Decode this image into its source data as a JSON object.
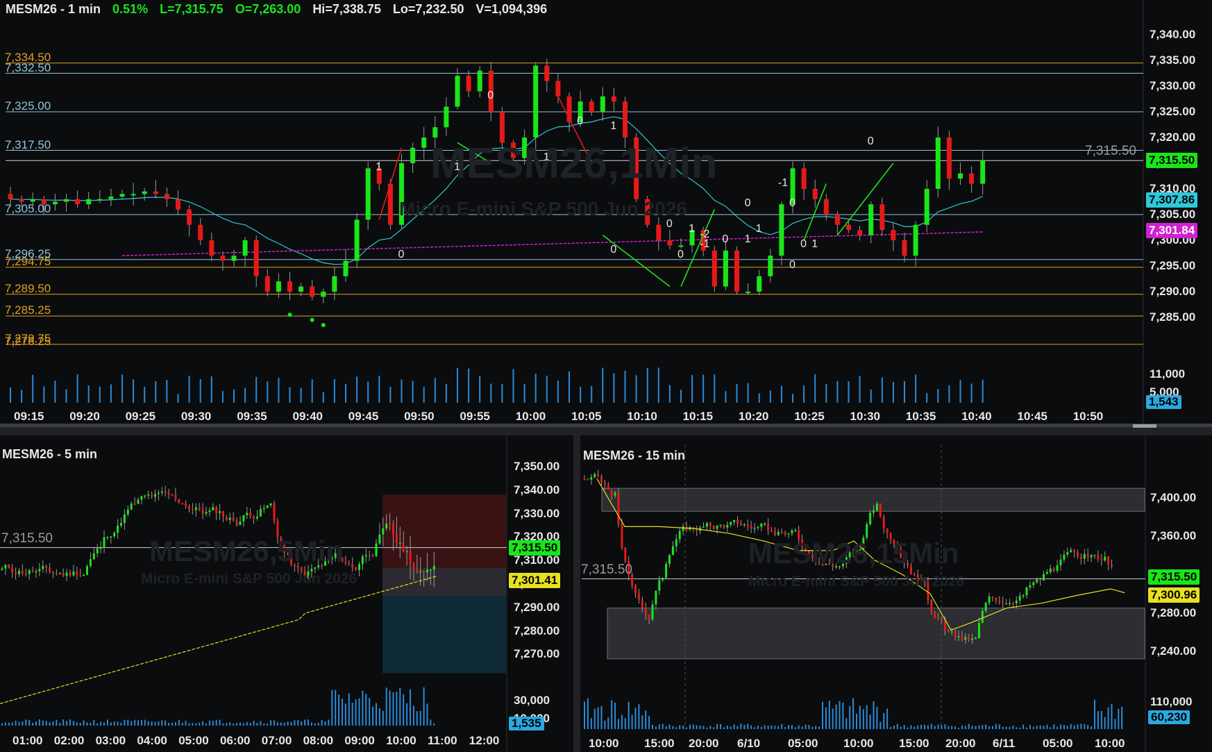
{
  "colors": {
    "bg": "#0b0c0e",
    "up": "#19e619",
    "down": "#e61919",
    "grid": "#1a1c20",
    "axis_text": "#e8e8e8",
    "hline_blue": "#8fc7df",
    "hline_orange": "#e0a020",
    "ema_cyan": "#2fc8d8",
    "vwap_magenta": "#d020d0",
    "sma_yellow": "#e8e020",
    "volume": "#2a8bd8"
  },
  "top": {
    "header": {
      "symbol": "MESM26 - 1 min",
      "change": "0.51%",
      "last": "L=7,315.75",
      "open": "O=7,263.00",
      "high": "Hi=7,338.75",
      "low": "Lo=7,232.50",
      "volume": "V=1,094,396"
    },
    "watermark": "MESM26,1Min",
    "watermark_sub": "Micro E-mini S&P 500 Jun 2026",
    "yaxis": [
      "7,340.00",
      "7,335.00",
      "7,330.00",
      "7,325.00",
      "7,320.00",
      "7,315.00",
      "7,310.00",
      "7,305.00",
      "7,300.00",
      "7,295.00",
      "7,290.00",
      "7,285.00"
    ],
    "price_tags": [
      {
        "text": "7,315.50",
        "price": 7315.5,
        "bg": "#19e619",
        "fg": "#000000"
      },
      {
        "text": "7,307.86",
        "price": 7307.86,
        "bg": "#2fc8d8",
        "fg": "#000000"
      },
      {
        "text": "7,301.84",
        "price": 7301.84,
        "bg": "#d020d0",
        "fg": "#ffffff"
      }
    ],
    "last_price_label": "7,315.50",
    "volume_axis": [
      "11,000",
      "5,000"
    ],
    "volume_tag": "1,543",
    "xaxis": [
      "09:15",
      "09:20",
      "09:25",
      "09:30",
      "09:35",
      "09:40",
      "09:45",
      "09:50",
      "09:55",
      "10:00",
      "10:05",
      "10:10",
      "10:15",
      "10:20",
      "10:25",
      "10:30",
      "10:35",
      "10:40",
      "10:45",
      "10:50"
    ],
    "hlines": [
      {
        "label": "7,334.50",
        "price": 7334.5,
        "color": "orange"
      },
      {
        "label": "7,332.50",
        "price": 7332.5,
        "color": "blue"
      },
      {
        "label": "7,325.00",
        "price": 7325.0,
        "color": "blue"
      },
      {
        "label": "7,317.50",
        "price": 7317.5,
        "color": "blue"
      },
      {
        "label": "7,305.00",
        "price": 7305.0,
        "color": "blue"
      },
      {
        "label": "7,296.25",
        "price": 7296.25,
        "color": "blue"
      },
      {
        "label": "7,294.75",
        "price": 7294.75,
        "color": "orange"
      },
      {
        "label": "7,289.50",
        "price": 7289.5,
        "color": "orange"
      },
      {
        "label": "7,285.25",
        "price": 7285.25,
        "color": "orange"
      },
      {
        "label": "7,279.75",
        "price": 7279.75,
        "color": "orange"
      },
      {
        "label": "7,276.25",
        "price": 7276.25,
        "color": "orange"
      }
    ],
    "annotations": [
      "1",
      "0",
      "1",
      "0",
      "0",
      "1",
      "0",
      "1",
      "0",
      "1",
      "0",
      "-1",
      "-2",
      "0",
      "1",
      "0",
      "1",
      "-1",
      "0",
      "0",
      "1",
      "0",
      "0"
    ]
  },
  "bottom_left": {
    "header": "MESM26 - 5 min",
    "watermark": "MESM26,5Min",
    "watermark_sub": "Micro E-mini S&P 500 Jun 2026",
    "yaxis": [
      "7,350.00",
      "7,340.00",
      "7,330.00",
      "7,320.00",
      "7,310.00",
      "7,300.00",
      "7,290.00",
      "7,280.00",
      "7,270.00"
    ],
    "price_tags": [
      {
        "text": "7,315.50",
        "price": 7315.5,
        "bg": "#19e619",
        "fg": "#000000"
      },
      {
        "text": "7,301.41",
        "price": 7301.41,
        "bg": "#e8e020",
        "fg": "#000000"
      }
    ],
    "last_price_label": "7,315.50",
    "volume_axis": [
      "30,000",
      "10,000"
    ],
    "volume_tag": "1,535",
    "xaxis": [
      "01:00",
      "02:00",
      "03:00",
      "04:00",
      "05:00",
      "06:00",
      "07:00",
      "08:00",
      "09:00",
      "10:00",
      "11:00",
      "12:00"
    ]
  },
  "bottom_right": {
    "header": "MESM26 - 15 min",
    "watermark": "MESM26,15Min",
    "watermark_sub": "Micro E-mini S&P 500 Jun 2026",
    "yaxis": [
      "7,400.00",
      "7,360.00",
      "7,320.00",
      "7,280.00",
      "7,240.00"
    ],
    "price_tags": [
      {
        "text": "7,315.50",
        "price": 7315.5,
        "bg": "#19e619",
        "fg": "#000000"
      },
      {
        "text": "7,300.96",
        "price": 7300.96,
        "bg": "#e8e020",
        "fg": "#000000"
      }
    ],
    "last_price_label": "7,315.50",
    "volume_axis": [
      "110,000"
    ],
    "volume_tag": "60,230",
    "xaxis": [
      "10:00",
      "15:00",
      "20:00",
      "6/10",
      "05:00",
      "10:00",
      "15:00",
      "20:00",
      "6/11",
      "05:00",
      "10:00"
    ]
  },
  "chart_data": [
    {
      "type": "candlestick",
      "title": "MESM26 - 1 min",
      "ylim": [
        7280,
        7342
      ],
      "x": [
        "09:15",
        "09:16",
        "09:17",
        "09:18",
        "09:19",
        "09:20",
        "09:21",
        "09:22",
        "09:23",
        "09:24",
        "09:25",
        "09:26",
        "09:27",
        "09:28",
        "09:29",
        "09:30",
        "09:31",
        "09:32",
        "09:33",
        "09:34",
        "09:35",
        "09:36",
        "09:37",
        "09:38",
        "09:39",
        "09:40",
        "09:41",
        "09:42",
        "09:43",
        "09:44",
        "09:45",
        "09:46",
        "09:47",
        "09:48",
        "09:49",
        "09:50",
        "09:51",
        "09:52",
        "09:53",
        "09:54",
        "09:55",
        "09:56",
        "09:57",
        "09:58",
        "09:59",
        "10:00",
        "10:01",
        "10:02",
        "10:03",
        "10:04",
        "10:05",
        "10:06",
        "10:07",
        "10:08",
        "10:09",
        "10:10",
        "10:11",
        "10:12",
        "10:13",
        "10:14",
        "10:15",
        "10:16",
        "10:17",
        "10:18",
        "10:19",
        "10:20",
        "10:21",
        "10:22",
        "10:23",
        "10:24",
        "10:25",
        "10:26",
        "10:27",
        "10:28",
        "10:29",
        "10:30",
        "10:31",
        "10:32",
        "10:33",
        "10:34",
        "10:35",
        "10:36",
        "10:37",
        "10:38",
        "10:39",
        "10:40"
      ],
      "open": [
        7309,
        7308,
        7307.5,
        7308,
        7307,
        7307.5,
        7308,
        7307,
        7308,
        7308,
        7308.5,
        7309,
        7309,
        7309.5,
        7309,
        7308,
        7306,
        7303,
        7300,
        7297,
        7296,
        7297,
        7300,
        7293,
        7290,
        7292,
        7290,
        7291,
        7289,
        7290,
        7293,
        7296,
        7304,
        7314,
        7311,
        7303,
        7315,
        7318,
        7320,
        7322,
        7326,
        7332,
        7329,
        7333,
        7325,
        7319,
        7316,
        7320,
        7334,
        7331,
        7328,
        7323,
        7327,
        7325,
        7328,
        7327,
        7320,
        7308,
        7303,
        7300,
        7299,
        7299,
        7302,
        7298,
        7291,
        7298,
        7290,
        7290,
        7293,
        7297,
        7307,
        7314,
        7310,
        7308,
        7305,
        7303,
        7302,
        7301,
        7307,
        7302,
        7300,
        7297,
        7303,
        7310,
        7320,
        7312,
        7313,
        7311
      ],
      "close": [
        7308,
        7307.5,
        7308,
        7307,
        7307.5,
        7308,
        7307,
        7308,
        7308,
        7308.5,
        7309,
        7309,
        7309.5,
        7309,
        7308,
        7306,
        7303,
        7300,
        7297,
        7296,
        7297,
        7300,
        7293,
        7290,
        7292,
        7290,
        7291,
        7289,
        7290,
        7293,
        7296,
        7304,
        7314,
        7311,
        7303,
        7315,
        7318,
        7320,
        7322,
        7326,
        7332,
        7329,
        7333,
        7325,
        7319,
        7316,
        7320,
        7334,
        7331,
        7328,
        7323,
        7327,
        7325,
        7328,
        7327,
        7320,
        7308,
        7303,
        7300,
        7299,
        7299,
        7302,
        7298,
        7291,
        7298,
        7290,
        7290,
        7293,
        7297,
        7307,
        7314,
        7310,
        7308,
        7305,
        7303,
        7302,
        7301,
        7307,
        7302,
        7300,
        7297,
        7303,
        7310,
        7320,
        7312,
        7313,
        7311,
        7315.5
      ],
      "volume_scale": "0-11000"
    },
    {
      "type": "candlestick",
      "title": "MESM26 - 5 min",
      "ylim": [
        7262,
        7356
      ],
      "x": [
        "01:00",
        "02:00",
        "03:00",
        "04:00",
        "05:00",
        "06:00",
        "07:00",
        "08:00",
        "09:00",
        "10:00",
        "11:00"
      ],
      "close": [
        7305,
        7307,
        7305,
        7322,
        7337,
        7335,
        7334,
        7320,
        7302,
        7308,
        7315.5
      ],
      "sma": 7301.41
    },
    {
      "type": "candlestick",
      "title": "MESM26 - 15 min",
      "ylim": [
        7226,
        7416
      ],
      "x": [
        "10:00",
        "15:00",
        "20:00",
        "6/10",
        "05:00",
        "10:00",
        "15:00",
        "20:00",
        "6/11",
        "05:00",
        "10:00"
      ],
      "close": [
        7420,
        7300,
        7370,
        7375,
        7355,
        7370,
        7330,
        7255,
        7300,
        7335,
        7315.5
      ],
      "sma": 7300.96
    }
  ]
}
